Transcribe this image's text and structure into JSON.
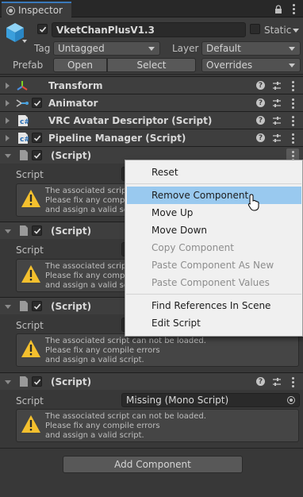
{
  "tab": {
    "label": "Inspector"
  },
  "gameobject": {
    "active": true,
    "name": "VketChanPlusV1.3",
    "static_label": "Static",
    "tag_label": "Tag",
    "tag_value": "Untagged",
    "layer_label": "Layer",
    "layer_value": "Default",
    "prefab_label": "Prefab",
    "open_label": "Open",
    "select_label": "Select",
    "overrides_label": "Overrides"
  },
  "components": [
    {
      "title": "Transform",
      "icon": "transform-icon",
      "has_checkbox": false
    },
    {
      "title": "Animator",
      "icon": "animator-icon",
      "has_checkbox": true
    },
    {
      "title": "VRC Avatar Descriptor (Script)",
      "icon": "script-icon",
      "has_checkbox": false
    },
    {
      "title": "Pipeline Manager (Script)",
      "icon": "script-icon",
      "has_checkbox": true
    }
  ],
  "missing_scripts": [
    {
      "title": "(Script)",
      "script_label": "Script",
      "field_value": ""
    },
    {
      "title": "(Script)",
      "script_label": "Script",
      "field_value": ""
    },
    {
      "title": "(Script)",
      "script_label": "Script",
      "field_value": ""
    },
    {
      "title": "(Script)",
      "script_label": "Script",
      "field_value": "Missing (Mono Script)"
    }
  ],
  "warning": {
    "line1": "The associated script can not be loaded.",
    "line2": "Please fix any compile errors",
    "line3": "and assign a valid script.",
    "partial1": "The associated script",
    "partial2": "Please fix any compil",
    "partial3": "and assign a valid scr"
  },
  "context_menu": {
    "items": [
      {
        "label": "Reset",
        "enabled": true
      },
      {
        "label": "Remove Component",
        "enabled": true,
        "highlighted": true
      },
      {
        "label": "Move Up",
        "enabled": true
      },
      {
        "label": "Move Down",
        "enabled": true
      },
      {
        "label": "Copy Component",
        "enabled": false
      },
      {
        "label": "Paste Component As New",
        "enabled": false
      },
      {
        "label": "Paste Component Values",
        "enabled": false
      },
      {
        "label": "Find References In Scene",
        "enabled": true
      },
      {
        "label": "Edit Script",
        "enabled": true
      }
    ]
  },
  "add_component_label": "Add Component",
  "colors": {
    "accent_tab": "#3a79bb",
    "menu_highlight": "#99c9ef",
    "warning_yellow": "#f4c02e"
  }
}
